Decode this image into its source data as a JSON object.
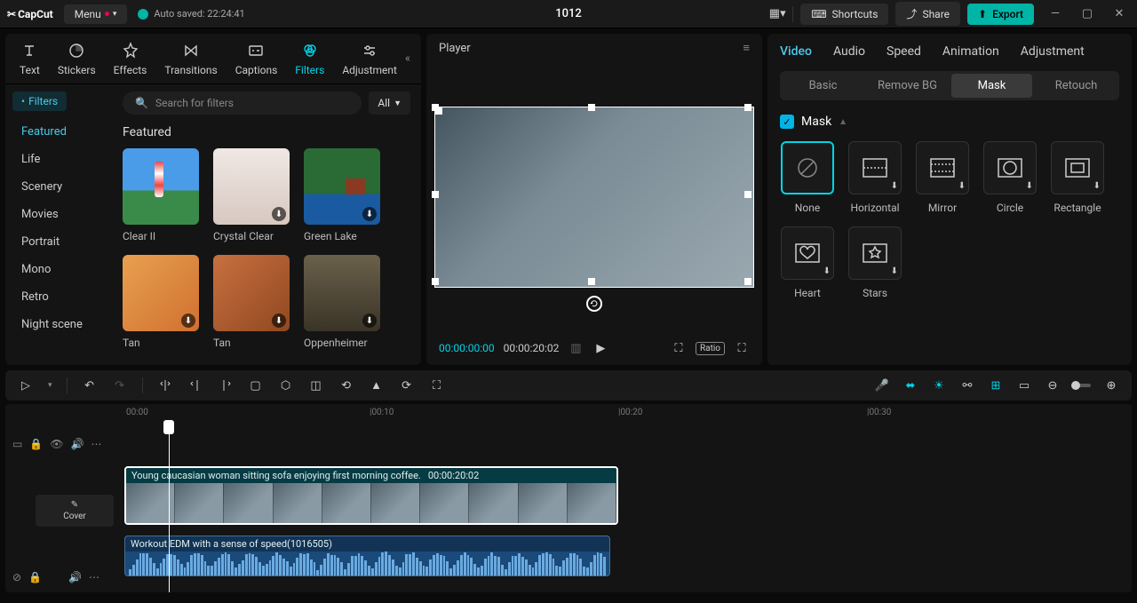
{
  "titlebar": {
    "logo": "CapCut",
    "menu": "Menu",
    "autosave": "Auto saved: 22:24:41",
    "project_title": "1012",
    "shortcuts": "Shortcuts",
    "share": "Share",
    "export": "Export"
  },
  "media_tabs": {
    "text": "Text",
    "stickers": "Stickers",
    "effects": "Effects",
    "transitions": "Transitions",
    "captions": "Captions",
    "filters": "Filters",
    "adjustment": "Adjustment"
  },
  "filters_panel": {
    "chip": "Filters",
    "categories": [
      "Featured",
      "Life",
      "Scenery",
      "Movies",
      "Portrait",
      "Mono",
      "Retro",
      "Night scene"
    ],
    "active_category": "Featured",
    "search_placeholder": "Search for filters",
    "all": "All",
    "section_title": "Featured",
    "items": [
      {
        "name": "Clear II"
      },
      {
        "name": "Crystal Clear"
      },
      {
        "name": "Green Lake"
      },
      {
        "name": "Tan"
      },
      {
        "name": "Tan"
      },
      {
        "name": "Oppenheimer"
      }
    ]
  },
  "player": {
    "title": "Player",
    "current": "00:00:00:00",
    "total": "00:00:20:02",
    "ratio": "Ratio"
  },
  "inspector": {
    "tabs": [
      "Video",
      "Audio",
      "Speed",
      "Animation",
      "Adjustment"
    ],
    "active_tab": "Video",
    "subtabs": [
      "Basic",
      "Remove BG",
      "Mask",
      "Retouch"
    ],
    "active_subtab": "Mask",
    "mask_label": "Mask",
    "masks": [
      {
        "name": "None"
      },
      {
        "name": "Horizontal"
      },
      {
        "name": "Mirror"
      },
      {
        "name": "Circle"
      },
      {
        "name": "Rectangle"
      },
      {
        "name": "Heart"
      },
      {
        "name": "Stars"
      }
    ],
    "active_mask": "None"
  },
  "timeline": {
    "ticks": [
      "00:00",
      "|00:10",
      "|00:20",
      "|00:30"
    ],
    "cover": "Cover",
    "video_clip": {
      "title": "Young caucasian woman sitting sofa enjoying first morning coffee.",
      "duration": "00:00:20:02"
    },
    "audio_clip": {
      "title": "Workout EDM with a sense of speed(1016505)"
    }
  }
}
